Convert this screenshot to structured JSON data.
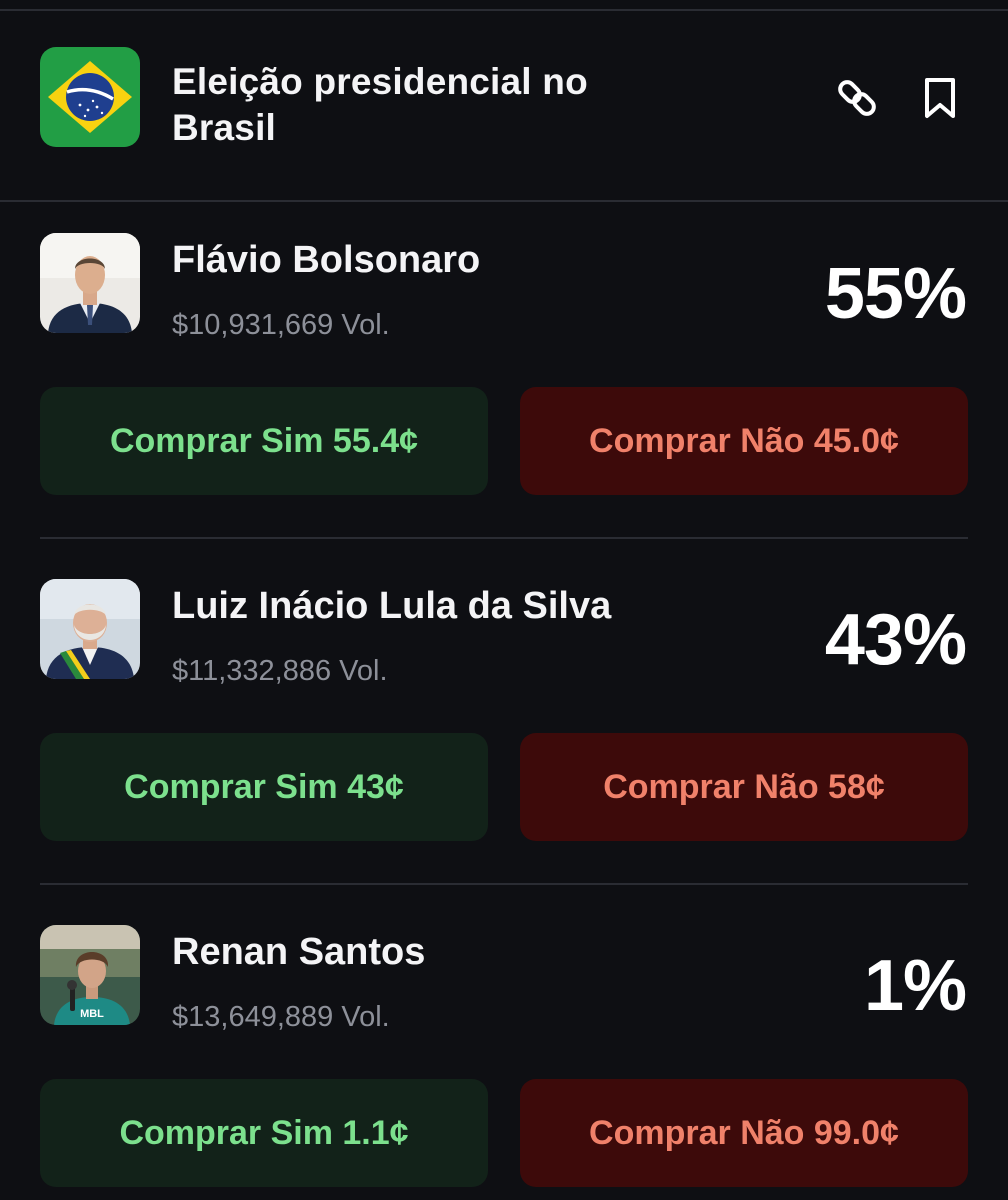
{
  "event": {
    "title": "Eleição presidencial no Brasil",
    "flag_icon": "brazil-flag-icon",
    "actions": {
      "link_icon": "link-icon",
      "bookmark_icon": "bookmark-icon"
    }
  },
  "colors": {
    "background": "#0e0f13",
    "yes_bg": "#122219",
    "yes_text": "#7ce08d",
    "no_bg": "#3d0a0a",
    "no_text": "#f0816a",
    "muted": "#8d9099"
  },
  "candidates": [
    {
      "name": "Flávio Bolsonaro",
      "volume": "$10,931,669 Vol.",
      "percent": "55%",
      "yes_label": "Comprar Sim 55.4¢",
      "no_label": "Comprar Não 45.0¢"
    },
    {
      "name": "Luiz Inácio Lula da Silva",
      "volume": "$11,332,886 Vol.",
      "percent": "43%",
      "yes_label": "Comprar Sim 43¢",
      "no_label": "Comprar Não 58¢"
    },
    {
      "name": "Renan Santos",
      "volume": "$13,649,889 Vol.",
      "percent": "1%",
      "yes_label": "Comprar Sim 1.1¢",
      "no_label": "Comprar Não 99.0¢"
    }
  ]
}
